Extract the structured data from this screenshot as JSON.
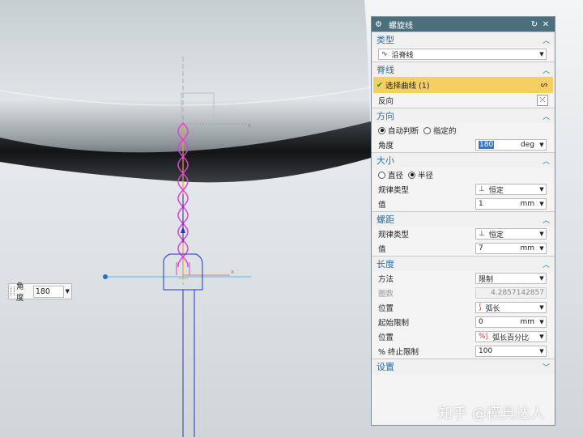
{
  "angle_widget": {
    "label": "角度",
    "value": "180"
  },
  "dialog": {
    "title": "螺旋线",
    "sections": {
      "type": {
        "header": "类型",
        "value": "沿脊线"
      },
      "spine": {
        "header": "脊线",
        "select_curve": "选择曲线 (1)",
        "reverse": "反向"
      },
      "orientation": {
        "header": "方向",
        "radio_auto": "自动判断",
        "radio_specified": "指定的",
        "selected": "自动判断",
        "angle_label": "角度",
        "angle_value": "180",
        "angle_unit": "deg"
      },
      "size": {
        "header": "大小",
        "radio_diameter": "直径",
        "radio_radius": "半径",
        "selected": "半径",
        "law_type_label": "规律类型",
        "law_type_value": "恒定",
        "value_label": "值",
        "value": "1",
        "unit": "mm"
      },
      "pitch": {
        "header": "螺距",
        "law_type_label": "规律类型",
        "law_type_value": "恒定",
        "value_label": "值",
        "value": "7",
        "unit": "mm"
      },
      "length": {
        "header": "长度",
        "method_label": "方法",
        "method_value": "限制",
        "turns_label": "圈数",
        "turns_value": "4.2857142857",
        "position1_label": "位置",
        "position1_value": "弧长",
        "start_limit_label": "起始限制",
        "start_limit_value": "0",
        "start_limit_unit": "mm",
        "position2_label": "位置",
        "position2_value": "弧长百分比",
        "end_limit_label": "% 终止限制",
        "end_limit_value": "100"
      },
      "settings": {
        "header": "设置"
      }
    }
  },
  "watermark": "知乎 @模具达人",
  "colors": {
    "titlebar": "#4b6f7c",
    "section_header_text": "#2d6fa3",
    "highlight": "#f4cf62",
    "helix": "#e040d8",
    "axis_blue": "#2233cc"
  }
}
